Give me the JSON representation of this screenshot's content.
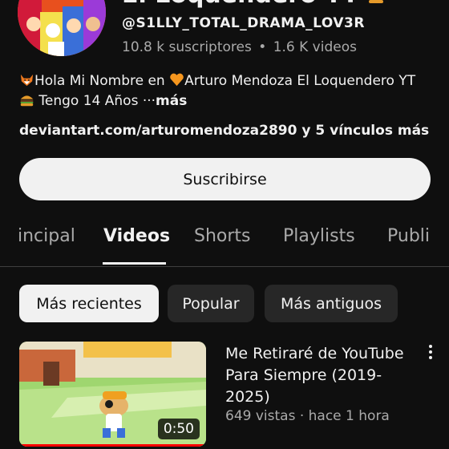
{
  "channel": {
    "name": "El Loquendero YT",
    "handle": "@S1LLY_TOTAL_DRAMA_LOV3R",
    "subscribers": "10.8 k suscriptores",
    "stats_separator": "•",
    "videos_count": "1.6 K videos",
    "description_line1": "Hola Mi Nombre en ",
    "description_line1b": "Arturo Mendoza El Loquendero YT",
    "description_line2": " Tengo 14 Años ···",
    "description_more": "más",
    "links": "deviantart.com/arturomendoza2890 y 5 vínculos más",
    "subscribe_label": "Suscribirse",
    "icons": [
      "burger-emoji-icon",
      "fox-emoji-icon",
      "orange-heart-emoji-icon"
    ]
  },
  "tabs": [
    {
      "label": "incipal",
      "active": false
    },
    {
      "label": "Videos",
      "active": true
    },
    {
      "label": "Shorts",
      "active": false
    },
    {
      "label": "Playlists",
      "active": false
    },
    {
      "label": "Publi",
      "active": false
    }
  ],
  "chips": [
    {
      "label": "Más recientes",
      "selected": true
    },
    {
      "label": "Popular",
      "selected": false
    },
    {
      "label": "Más antiguos",
      "selected": false
    }
  ],
  "videos": [
    {
      "title": "Me Retiraré de YouTube Para Siempre (2019-2025)",
      "meta": "649 vistas · hace 1 hora",
      "duration": "0:50"
    }
  ],
  "colors": {
    "background": "#0f0f0f",
    "text": "#f1f1f1",
    "secondary_text": "#aaaaaa",
    "chip_bg": "#272727",
    "progress_red": "#ff0000"
  }
}
